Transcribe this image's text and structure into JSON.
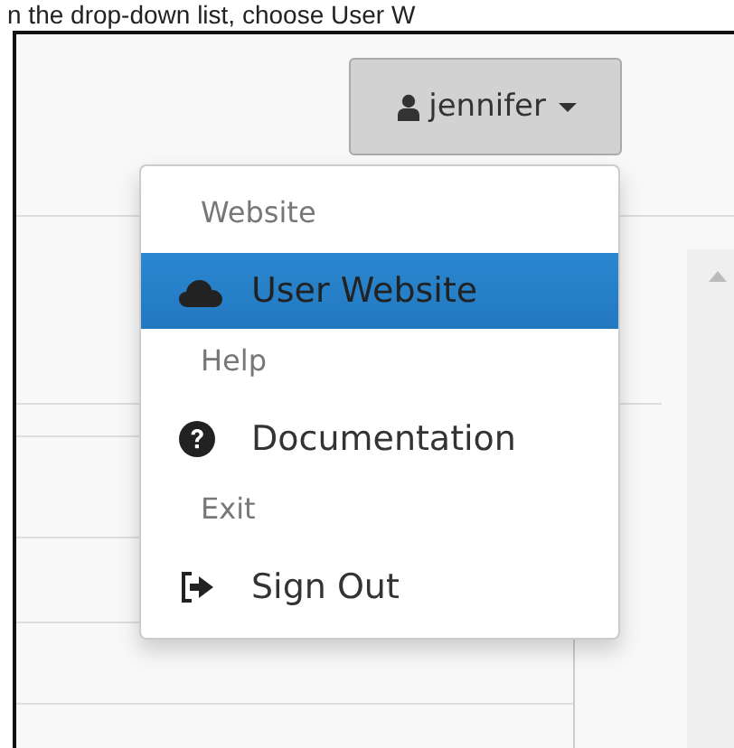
{
  "caption": "n the drop-down list, choose User W",
  "user_button": {
    "label": "jennifer",
    "expanded": true
  },
  "menu": [
    {
      "kind": "header",
      "label": "Website"
    },
    {
      "kind": "item",
      "label": "User Website",
      "selected": true
    },
    {
      "kind": "header",
      "label": "Help"
    },
    {
      "kind": "item",
      "label": "Documentation",
      "selected": false
    },
    {
      "kind": "header",
      "label": "Exit"
    },
    {
      "kind": "item",
      "label": "Sign Out",
      "selected": false
    }
  ]
}
